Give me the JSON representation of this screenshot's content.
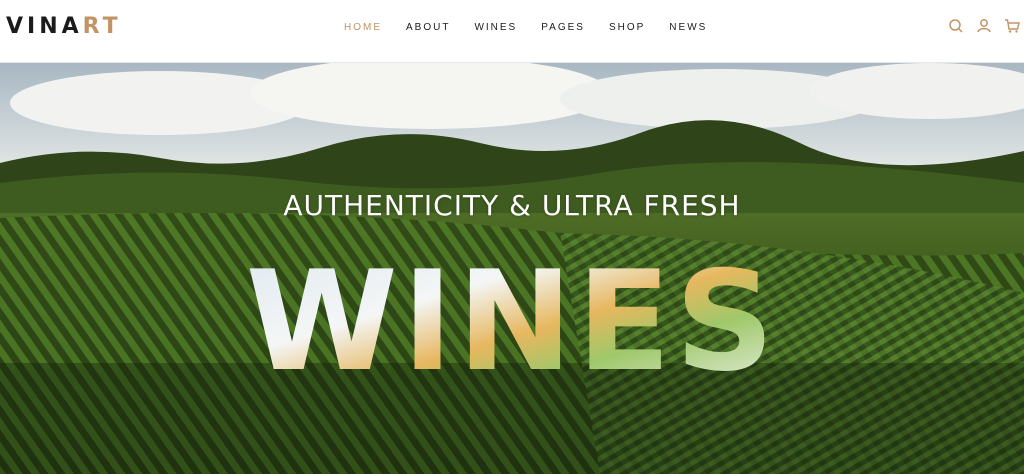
{
  "logo": {
    "text_main": "VINA",
    "text_accent": "RT"
  },
  "nav": {
    "items": [
      {
        "label": "HOME",
        "active": true
      },
      {
        "label": "ABOUT",
        "active": false
      },
      {
        "label": "WINES",
        "active": false
      },
      {
        "label": "PAGES",
        "active": false
      },
      {
        "label": "SHOP",
        "active": false
      },
      {
        "label": "NEWS",
        "active": false
      }
    ]
  },
  "header_icons": [
    "search-icon",
    "user-icon",
    "cart-icon"
  ],
  "hero": {
    "subtitle": "AUTHENTICITY & ULTRA FRESH",
    "headline": "WINES"
  },
  "colors": {
    "accent": "#c39463",
    "text": "#1b1b1b"
  }
}
